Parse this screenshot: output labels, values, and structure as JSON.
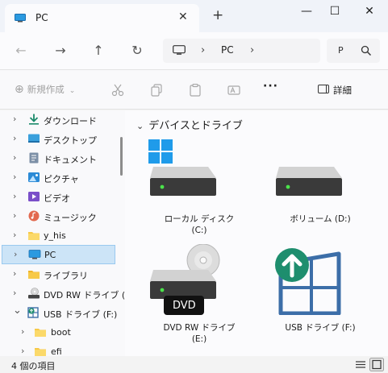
{
  "window": {
    "tab_title": "PC",
    "close_glyph": "✕",
    "newtab_glyph": "+",
    "min_glyph": "—",
    "max_glyph": "☐",
    "winclose_glyph": "✕"
  },
  "nav": {
    "back_glyph": "←",
    "forward_glyph": "→",
    "up_glyph": "↑",
    "refresh_glyph": "↻",
    "breadcrumb": [
      "PC"
    ],
    "chevron": "›",
    "search_placeholder": "P"
  },
  "toolbar": {
    "new_label": "新規作成",
    "more_glyph": "···",
    "details_label": "詳細"
  },
  "sidebar": {
    "items": [
      {
        "label": "ダウンロード",
        "icon": "download-icon",
        "chevron": "›"
      },
      {
        "label": "デスクトップ",
        "icon": "desktop-icon",
        "chevron": "›"
      },
      {
        "label": "ドキュメント",
        "icon": "document-icon",
        "chevron": "›"
      },
      {
        "label": "ピクチャ",
        "icon": "pictures-icon",
        "chevron": "›"
      },
      {
        "label": "ビデオ",
        "icon": "videos-icon",
        "chevron": "›"
      },
      {
        "label": "ミュージック",
        "icon": "music-icon",
        "chevron": "›"
      },
      {
        "label": "y_his",
        "icon": "folder-icon",
        "chevron": "›"
      },
      {
        "label": "PC",
        "icon": "pc-icon",
        "chevron": "›",
        "selected": true
      },
      {
        "label": "ライブラリ",
        "icon": "library-icon",
        "chevron": "›"
      },
      {
        "label": "DVD RW ドライブ (",
        "icon": "dvd-drive-icon",
        "chevron": "›"
      },
      {
        "label": "USB ドライブ (F:)",
        "icon": "usb-drive-icon",
        "chevron": "⌄"
      },
      {
        "label": "boot",
        "icon": "folder-icon",
        "chevron": "›"
      },
      {
        "label": "efi",
        "icon": "folder-icon",
        "chevron": "›"
      }
    ]
  },
  "content": {
    "group_title": "デバイスとドライブ",
    "group_chevron": "⌄",
    "drives": [
      {
        "line1": "ローカル ディスク",
        "line2": "(C:)",
        "icon": "local-disk-icon"
      },
      {
        "line1": "ボリューム (D:)",
        "line2": "",
        "icon": "volume-icon"
      },
      {
        "line1": "DVD RW ドライブ",
        "line2": "(E:)",
        "icon": "dvd-drive-icon",
        "badge": "DVD"
      },
      {
        "line1": "USB ドライブ (F:)",
        "line2": "",
        "icon": "usb-drive-icon"
      }
    ]
  },
  "status": {
    "count_text": "4 個の項目"
  },
  "colors": {
    "accent": "#0078d4",
    "selected_bg": "#cce4f7",
    "usb_green": "#1e8e6e",
    "usb_blue": "#3c6ea8",
    "folder": "#f7c948"
  }
}
